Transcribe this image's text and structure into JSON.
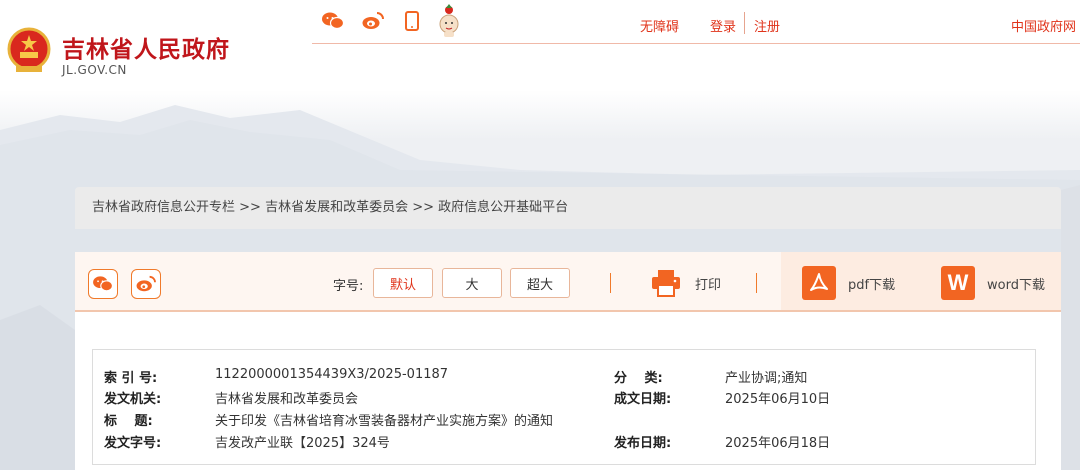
{
  "header": {
    "site_title": "吉林省人民政府",
    "site_domain": "JL.GOV.CN",
    "icons": [
      "wechat-icon",
      "weibo-icon",
      "mobile-icon",
      "mascot-icon"
    ],
    "links": {
      "accessibility": "无障碍",
      "login": "登录",
      "register": "注册",
      "china_gov": "中国政府网"
    }
  },
  "breadcrumb": {
    "items": [
      "吉林省政府信息公开专栏",
      "吉林省发展和改革委员会",
      "政府信息公开基础平台"
    ],
    "separator": " >> "
  },
  "toolbar": {
    "font_size_label": "字号:",
    "font_default": "默认",
    "font_large": "大",
    "font_xlarge": "超大",
    "print": "打印",
    "pdf_download": "pdf下载",
    "word_download": "word下载",
    "word_icon_letter": "W"
  },
  "info": {
    "index_label": "索 引 号:",
    "index_value": "1122000001354439X3/2025-01187",
    "category_label": "分　 类:",
    "category_value": "产业协调;通知",
    "issuer_label": "发文机关:",
    "issuer_value": "吉林省发展和改革委员会",
    "date_written_label": "成文日期:",
    "date_written_value": "2025年06月10日",
    "title_label": "标　 题:",
    "title_value": "关于印发《吉林省培育冰雪装备器材产业实施方案》的通知",
    "doc_no_label": "发文字号:",
    "doc_no_value": "吉发改产业联【2025】324号",
    "publish_date_label": "发布日期:",
    "publish_date_value": "2025年06月18日"
  },
  "colors": {
    "brand_red": "#c0161b",
    "link_red": "#e0331a",
    "accent_orange": "#f26522"
  }
}
